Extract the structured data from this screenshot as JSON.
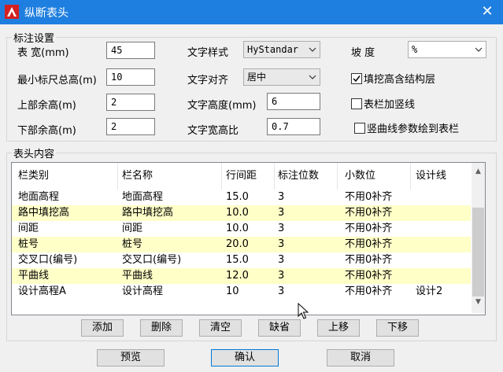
{
  "window": {
    "title": "纵断表头",
    "close_symbol": "✕"
  },
  "annotation": {
    "legend": "标注设置",
    "table_width_label": "表   宽(mm)",
    "table_width_value": "45",
    "min_height_label": "最小标尺总高(m)",
    "min_height_value": "10",
    "top_margin_label": "上部余高(m)",
    "top_margin_value": "2",
    "bottom_margin_label": "下部余高(m)",
    "bottom_margin_value": "2",
    "text_style_label": "文字样式",
    "text_style_value": "HyStandar",
    "text_align_label": "文字对齐",
    "text_align_value": "居中",
    "text_height_label": "文字高度(mm)",
    "text_height_value": "6",
    "text_ratio_label": "文字宽高比",
    "text_ratio_value": "0.7",
    "slope_label": "坡    度",
    "slope_value": "%",
    "chk_fill_label": "填挖高含结构层",
    "chk_fill_checked": true,
    "chk_vline_label": "表栏加竖线",
    "chk_vline_checked": false,
    "chk_curve_label": "竖曲线参数绘到表栏",
    "chk_curve_checked": false
  },
  "content": {
    "legend": "表头内容",
    "columns": [
      "栏类别",
      "栏名称",
      "行间距",
      "标注位数",
      "小数位",
      "设计线"
    ],
    "rows": [
      {
        "c": [
          "地面高程",
          "地面高程",
          "15.0",
          "3",
          "不用0补齐",
          ""
        ],
        "highlight": false
      },
      {
        "c": [
          "路中填挖高",
          "路中填挖高",
          "10.0",
          "3",
          "不用0补齐",
          ""
        ],
        "highlight": true
      },
      {
        "c": [
          "间距",
          "间距",
          "10.0",
          "3",
          "不用0补齐",
          ""
        ],
        "highlight": false
      },
      {
        "c": [
          "桩号",
          "桩号",
          "20.0",
          "3",
          "不用0补齐",
          ""
        ],
        "highlight": true
      },
      {
        "c": [
          "交叉口(编号)",
          "交叉口(编号)",
          "15.0",
          "3",
          "不用0补齐",
          ""
        ],
        "highlight": false
      },
      {
        "c": [
          "平曲线",
          "平曲线",
          "12.0",
          "3",
          "不用0补齐",
          ""
        ],
        "highlight": true
      },
      {
        "c": [
          "设计高程A",
          "设计高程",
          "10",
          "3",
          "不用0补齐",
          "设计2"
        ],
        "highlight": false
      }
    ]
  },
  "buttons": {
    "add": "添加",
    "delete": "删除",
    "clear": "清空",
    "default": "缺省",
    "move_up": "上移",
    "move_down": "下移",
    "preview": "预览",
    "confirm": "确认",
    "cancel": "取消"
  },
  "colors": {
    "titlebar": "#1f7fe0",
    "row_highlight": "#ffffc8",
    "default_button_border": "#0078d7"
  }
}
